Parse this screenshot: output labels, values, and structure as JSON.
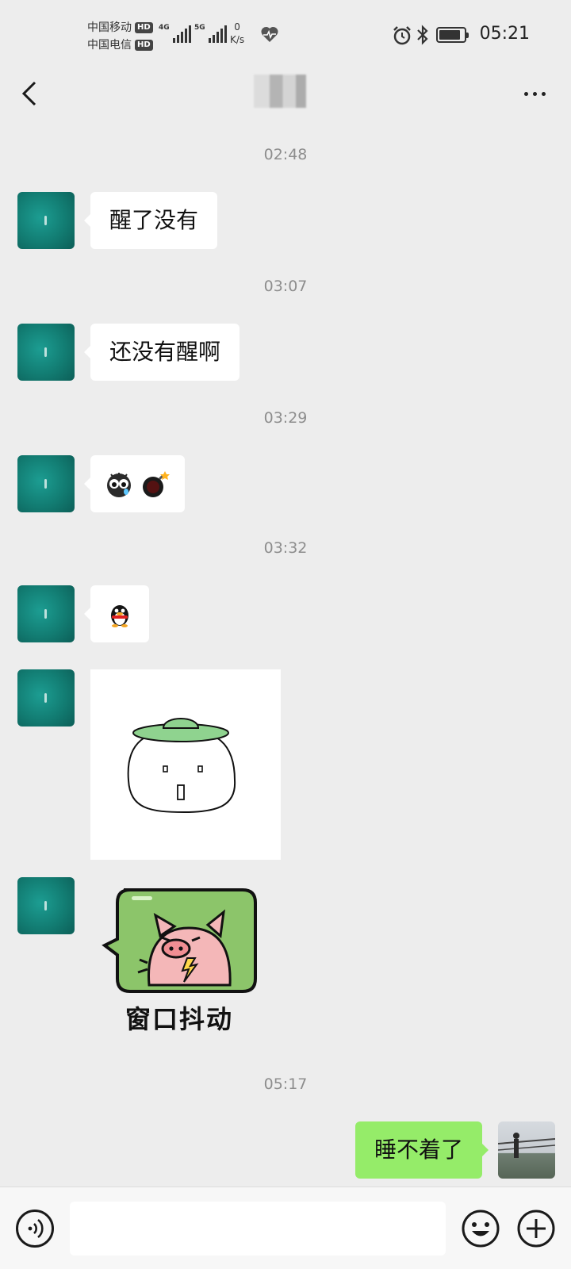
{
  "status_bar": {
    "carrier_1": "中国移动",
    "carrier_2": "中国电信",
    "hd_badge": "HD",
    "signal_1_type": "4G",
    "signal_2_type": "5G",
    "net_speed_value": "0",
    "net_speed_unit": "K/s",
    "time": "05:21",
    "battery_level": 0.85
  },
  "chat": {
    "messages": [
      {
        "time": "02:48",
        "text": "醒了没有"
      },
      {
        "time": "03:07",
        "text": "还没有醒啊"
      },
      {
        "time": "03:29",
        "emojis": [
          "crying-face-emoji",
          "bomb-emoji"
        ]
      },
      {
        "time": "03:32",
        "emojis": [
          "qq-penguin-emoji"
        ]
      },
      {
        "sticker": "green-hat-dumpling-sticker"
      },
      {
        "sticker": "pig-window-shake-sticker",
        "sticker_text": "窗口抖动"
      },
      {
        "time": "05:17",
        "text": "睡不着了",
        "outgoing": true
      }
    ]
  },
  "input": {
    "placeholder": ""
  }
}
